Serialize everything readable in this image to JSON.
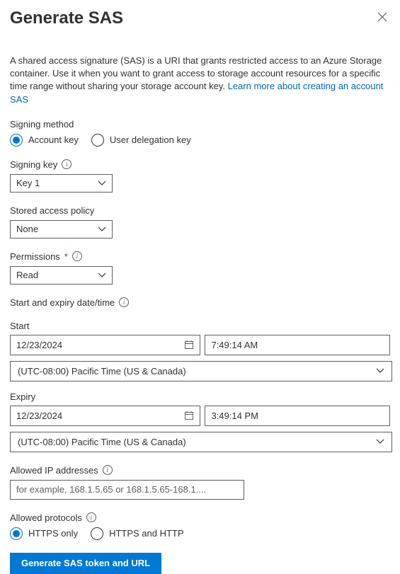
{
  "header": {
    "title": "Generate SAS"
  },
  "intro": {
    "text": "A shared access signature (SAS) is a URI that grants restricted access to an Azure Storage container. Use it when you want to grant access to storage account resources for a specific time range without sharing your storage account key. ",
    "link_text": "Learn more about creating an account SAS"
  },
  "signing_method": {
    "label": "Signing method",
    "options": {
      "account_key": "Account key",
      "user_delegation": "User delegation key"
    }
  },
  "signing_key": {
    "label": "Signing key",
    "value": "Key 1"
  },
  "stored_access_policy": {
    "label": "Stored access policy",
    "value": "None"
  },
  "permissions": {
    "label": "Permissions",
    "value": "Read"
  },
  "datetime": {
    "section_label": "Start and expiry date/time",
    "start_label": "Start",
    "start_date": "12/23/2024",
    "start_time": "7:49:14 AM",
    "start_tz": "(UTC-08:00) Pacific Time (US & Canada)",
    "expiry_label": "Expiry",
    "expiry_date": "12/23/2024",
    "expiry_time": "3:49:14 PM",
    "expiry_tz": "(UTC-08:00) Pacific Time (US & Canada)"
  },
  "allowed_ip": {
    "label": "Allowed IP addresses",
    "placeholder": "for example, 168.1.5.65 or 168.1.5.65-168.1...."
  },
  "allowed_protocols": {
    "label": "Allowed protocols",
    "options": {
      "https_only": "HTTPS only",
      "https_and_http": "HTTPS and HTTP"
    }
  },
  "actions": {
    "generate": "Generate SAS token and URL"
  }
}
